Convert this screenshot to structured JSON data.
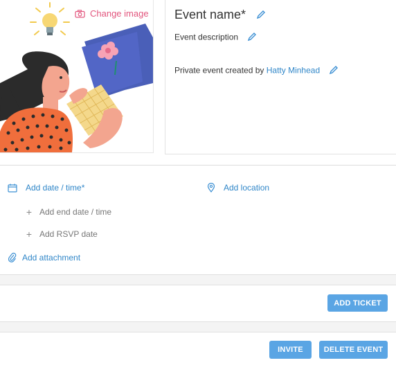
{
  "image_panel": {
    "change_image_label": "Change image"
  },
  "event": {
    "name": "Event name*",
    "description": "Event description",
    "creator_prefix": "Private event created by",
    "creator_name": "Hatty Minhead"
  },
  "schedule": {
    "add_date_time": "Add date / time*",
    "add_location": "Add location",
    "add_end_date_time": "Add end date / time",
    "add_rsvp_date": "Add RSVP date",
    "add_attachment": "Add attachment"
  },
  "tickets": {
    "add_ticket_label": "ADD TICKET"
  },
  "footer": {
    "invite_label": "INVITE",
    "delete_label": "DELETE EVENT"
  },
  "colors": {
    "link": "#2f86c8",
    "button": "#5aa5e4",
    "change_image": "#e2557d"
  }
}
